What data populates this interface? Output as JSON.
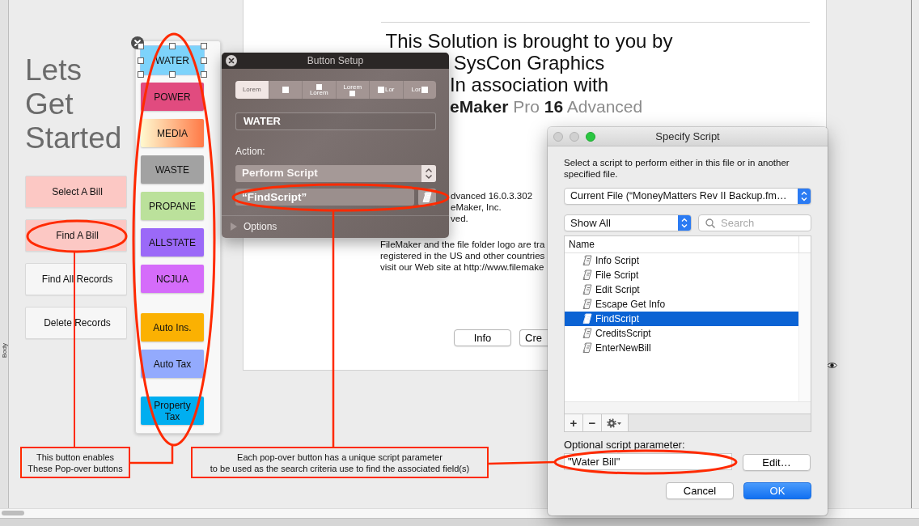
{
  "layout_part": {
    "label": "Body"
  },
  "sidebar": {
    "title": "Lets Get Started",
    "buttons": [
      {
        "label": "Select A Bill",
        "color": "#fcc8c4"
      },
      {
        "label": "Find A Bill",
        "color": "#fcc8c4"
      },
      {
        "label": "Find All Records",
        "color": "#f6f6f6"
      },
      {
        "label": "Delete Records",
        "color": "#f6f6f6"
      }
    ]
  },
  "popover": {
    "buttons": [
      {
        "label": "WATER",
        "kind": "solid",
        "color": "#7dd3fb",
        "selected": true
      },
      {
        "label": "POWER",
        "kind": "solid",
        "color": "#e14b7f",
        "selected": false
      },
      {
        "label": "MEDIA",
        "kind": "gradient",
        "color": "#ff7946",
        "selected": false
      },
      {
        "label": "WASTE",
        "kind": "solid",
        "color": "#a2a2a2",
        "selected": false
      },
      {
        "label": "PROPANE",
        "kind": "solid",
        "color": "#bbe19b",
        "selected": false
      },
      {
        "label": "ALLSTATE",
        "kind": "solid",
        "color": "#9b69f8",
        "selected": false
      },
      {
        "label": "NCJUA",
        "kind": "solid",
        "color": "#d56cfa",
        "selected": false
      },
      {
        "label": "Auto Ins.",
        "kind": "solid",
        "color": "#fbb102",
        "selected": false
      },
      {
        "label": "Auto Tax",
        "kind": "solid",
        "color": "#93aafd",
        "selected": false
      },
      {
        "label": "Property Tax",
        "kind": "solid",
        "color": "#00aef0",
        "selected": false
      }
    ]
  },
  "about_card": {
    "heading_lines": [
      "This Solution is brought to you by",
      "SysCon Graphics",
      "In association with"
    ],
    "logo": "**eMaker** Pro **16** Advanced",
    "version_lines": [
      "dvanced 16.0.3.302",
      "eMaker, Inc.",
      "ved."
    ],
    "legal_lines": [
      "FileMaker and the file folder logo are tra",
      "registered in the US and other countries",
      "visit our Web site at http://www.filemake"
    ],
    "buttons": [
      {
        "label": "Info",
        "kind": "full"
      },
      {
        "label": "Cre",
        "kind": "partial"
      }
    ]
  },
  "button_setup": {
    "title": "Button Setup",
    "label_positions": [
      {
        "kind": "text",
        "label": "Lorem",
        "selected": true
      },
      {
        "kind": "icon",
        "selected": false
      },
      {
        "kind": "below",
        "label": "Lorem",
        "selected": false
      },
      {
        "kind": "above",
        "label": "Lorem",
        "selected": false
      },
      {
        "kind": "right",
        "label": "Lor",
        "selected": false
      },
      {
        "kind": "left",
        "label": "Lor",
        "selected": false
      }
    ],
    "button_label": "WATER",
    "action_label": "Action:",
    "action": "Perform Script",
    "script": "“FindScript”",
    "options": "Options"
  },
  "specify_script": {
    "title": "Specify Script",
    "instructions": "Select a script to perform either in this file or in another specified file.",
    "file": "Current File (“MoneyMatters Rev II Backup.fm…",
    "filter": "Show All",
    "search": {
      "placeholder": "Search"
    },
    "column": "Name",
    "scripts": [
      {
        "name": "Info Script",
        "selected": false
      },
      {
        "name": "File Script",
        "selected": false
      },
      {
        "name": "Edit Script",
        "selected": false
      },
      {
        "name": "Escape Get Info",
        "selected": false
      },
      {
        "name": "FindScript",
        "selected": true
      },
      {
        "name": "CreditsScript",
        "selected": false
      },
      {
        "name": "EnterNewBill",
        "selected": false
      }
    ],
    "toolbar": [
      {
        "kind": "add",
        "label": "+"
      },
      {
        "kind": "remove",
        "label": "−"
      },
      {
        "kind": "gear"
      }
    ],
    "parameter_label": "Optional script parameter:",
    "parameter": "\"Water Bill\"",
    "edit": "Edit…",
    "cancel": "Cancel",
    "ok": "OK"
  },
  "annotations": {
    "callouts": [
      "This button enables\nThese Pop-over buttons",
      "Each pop-over button has a unique script parameter\nto be used as the search criteria use to find the associated field(s)"
    ]
  }
}
